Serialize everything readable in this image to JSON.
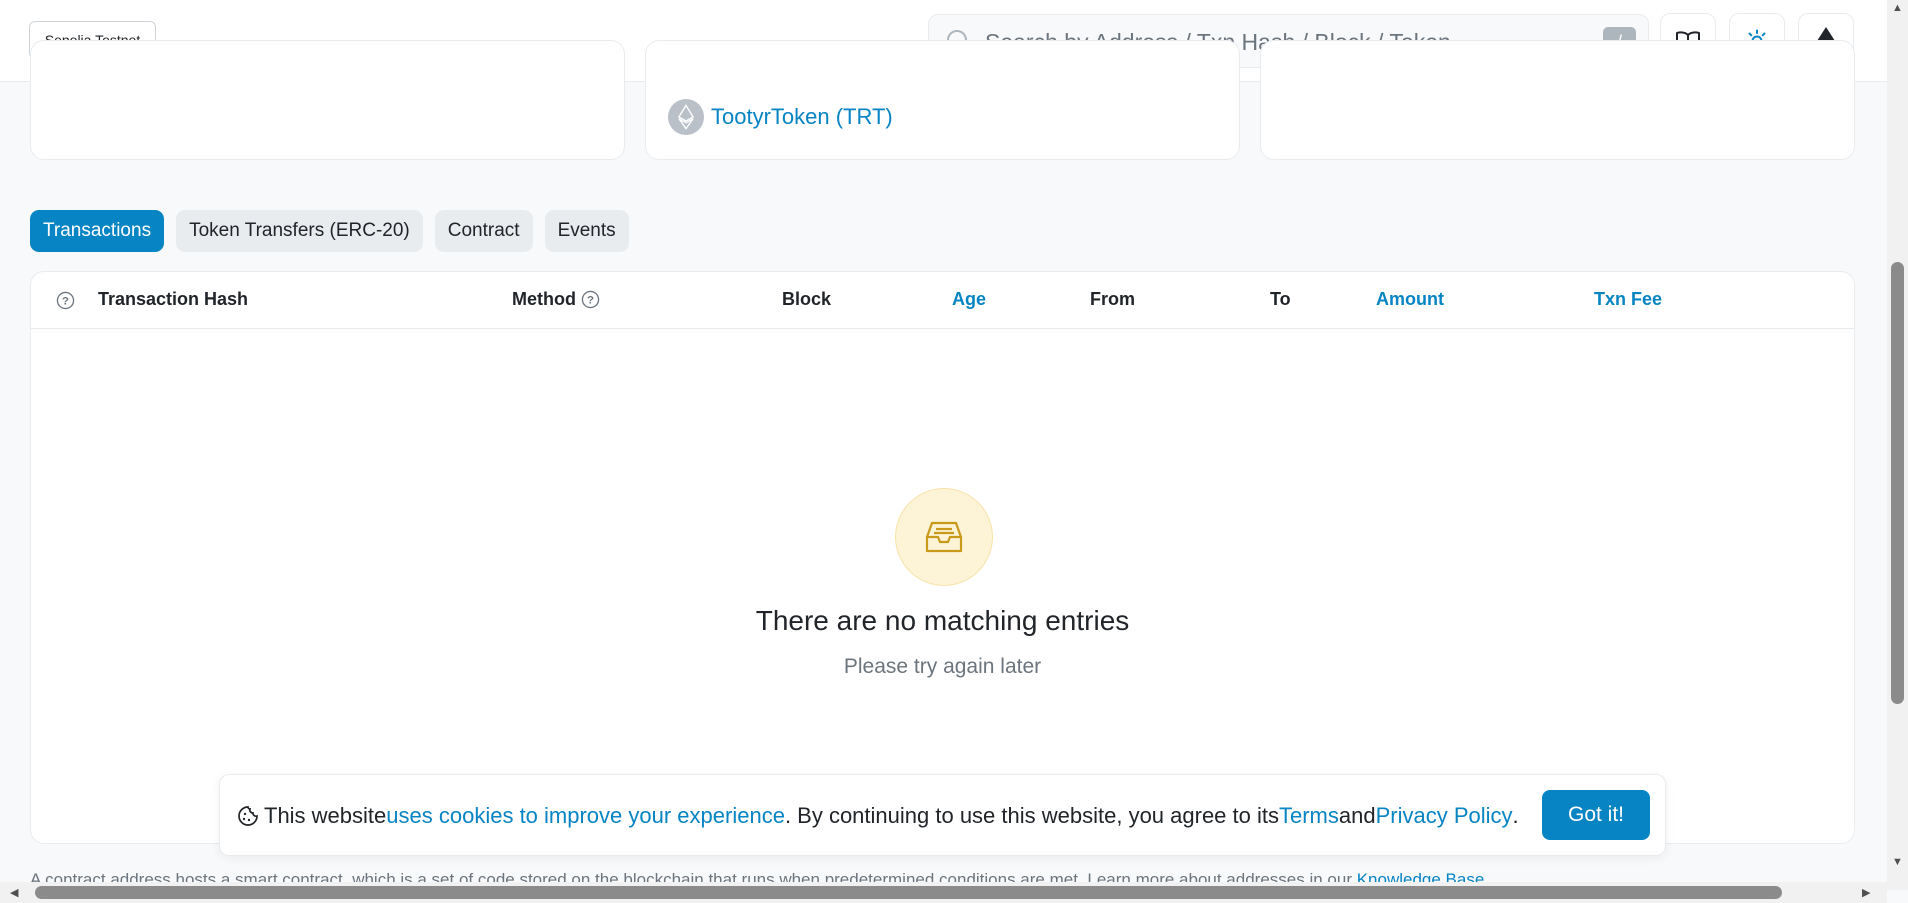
{
  "header": {
    "network": "Sepolia Testnet",
    "search": {
      "placeholder": "Search by Address / Txn Hash / Block / Token",
      "shortcut": "/"
    },
    "buttons": [
      "book-icon",
      "sun-icon",
      "ethereum-icon"
    ]
  },
  "token": {
    "name": "TootyrToken (TRT)"
  },
  "tabs": [
    {
      "label": "Transactions",
      "active": true
    },
    {
      "label": "Token Transfers (ERC-20)",
      "active": false
    },
    {
      "label": "Contract",
      "active": false
    },
    {
      "label": "Events",
      "active": false
    }
  ],
  "table": {
    "columns": [
      {
        "label": "Transaction Hash",
        "link": false
      },
      {
        "label": "Method",
        "link": false
      },
      {
        "label": "Block",
        "link": false
      },
      {
        "label": "Age",
        "link": true
      },
      {
        "label": "From",
        "link": false
      },
      {
        "label": "To",
        "link": false
      },
      {
        "label": "Amount",
        "link": true
      },
      {
        "label": "Txn Fee",
        "link": true
      }
    ],
    "empty": {
      "title": "There are no matching entries",
      "subtitle": "Please try again later"
    }
  },
  "footer": {
    "note_text": "A contract address hosts a smart contract, which is a set of code stored on the blockchain that runs when predetermined conditions are met. Learn more about addresses in our ",
    "note_link": "Knowledge Base"
  },
  "cookie": {
    "text1": "This website ",
    "link1": "uses cookies to improve your experience",
    "text2": ". By continuing to use this website, you agree to its ",
    "link2": "Terms",
    "text3": " and ",
    "link3": "Privacy Policy",
    "text4": ".",
    "button": "Got it!"
  },
  "colors": {
    "accent": "#0784c3",
    "empty_icon": "#c99a1a"
  }
}
